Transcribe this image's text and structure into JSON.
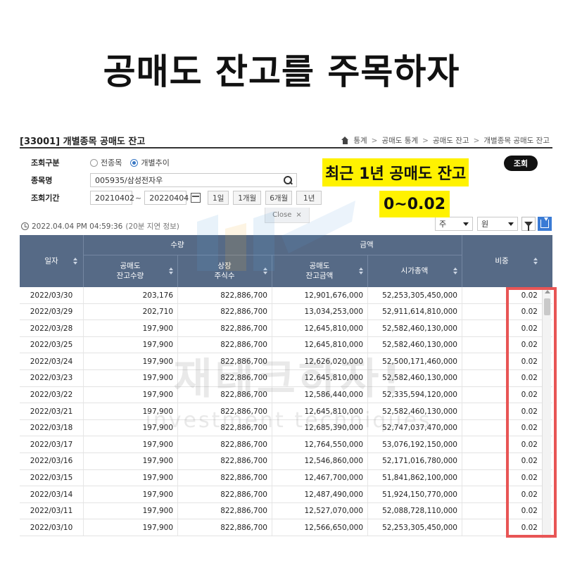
{
  "headline": "공매도 잔고를 주목하자",
  "screen": {
    "title": "[33001] 개별종목 공매도 잔고",
    "breadcrumb": [
      "통계",
      "공매도 통계",
      "공매도 잔고",
      "개별종목 공매도 잔고"
    ],
    "breadcrumb_sep": ">"
  },
  "form": {
    "lookup_type_label": "조회구분",
    "radio_all": "전종목",
    "radio_individual": "개별추이",
    "selected_radio": "개별추이",
    "stock_label": "종목명",
    "stock_value": "005935/삼성전자우",
    "period_label": "조회기간",
    "date_from": "20210402",
    "date_sep": "~",
    "date_to": "20220404",
    "period_buttons": [
      "1일",
      "1개월",
      "6개월",
      "1년"
    ],
    "query_button": "조회",
    "close_label": "Close",
    "close_x": "×"
  },
  "toolbar": {
    "timestamp": "2022.04.04 PM 04:59:36",
    "timestamp_note": "(20분 지연 정보)",
    "unit_select": "주",
    "currency_select": "원"
  },
  "table": {
    "group_headers": {
      "quantity": "수량",
      "amount": "금액"
    },
    "headers": {
      "date": "일자",
      "short_qty": [
        "공매도",
        "잔고수량"
      ],
      "listed_shares": [
        "상장",
        "주식수"
      ],
      "short_amount": [
        "공매도",
        "잔고금액"
      ],
      "market_cap": "시가총액",
      "ratio": "비중"
    },
    "rows": [
      [
        "2022/03/30",
        "203,176",
        "822,886,700",
        "12,901,676,000",
        "52,253,305,450,000",
        "0.02"
      ],
      [
        "2022/03/29",
        "202,710",
        "822,886,700",
        "13,034,253,000",
        "52,911,614,810,000",
        "0.02"
      ],
      [
        "2022/03/28",
        "197,900",
        "822,886,700",
        "12,645,810,000",
        "52,582,460,130,000",
        "0.02"
      ],
      [
        "2022/03/25",
        "197,900",
        "822,886,700",
        "12,645,810,000",
        "52,582,460,130,000",
        "0.02"
      ],
      [
        "2022/03/24",
        "197,900",
        "822,886,700",
        "12,626,020,000",
        "52,500,171,460,000",
        "0.02"
      ],
      [
        "2022/03/23",
        "197,900",
        "822,886,700",
        "12,645,810,000",
        "52,582,460,130,000",
        "0.02"
      ],
      [
        "2022/03/22",
        "197,900",
        "822,886,700",
        "12,586,440,000",
        "52,335,594,120,000",
        "0.02"
      ],
      [
        "2022/03/21",
        "197,900",
        "822,886,700",
        "12,645,810,000",
        "52,582,460,130,000",
        "0.02"
      ],
      [
        "2022/03/18",
        "197,900",
        "822,886,700",
        "12,685,390,000",
        "52,747,037,470,000",
        "0.02"
      ],
      [
        "2022/03/17",
        "197,900",
        "822,886,700",
        "12,764,550,000",
        "53,076,192,150,000",
        "0.02"
      ],
      [
        "2022/03/16",
        "197,900",
        "822,886,700",
        "12,546,860,000",
        "52,171,016,780,000",
        "0.02"
      ],
      [
        "2022/03/15",
        "197,900",
        "822,886,700",
        "12,467,700,000",
        "51,841,862,100,000",
        "0.02"
      ],
      [
        "2022/03/14",
        "197,900",
        "822,886,700",
        "12,487,490,000",
        "51,924,150,770,000",
        "0.02"
      ],
      [
        "2022/03/11",
        "197,900",
        "822,886,700",
        "12,527,070,000",
        "52,088,728,110,000",
        "0.02"
      ],
      [
        "2022/03/10",
        "197,900",
        "822,886,700",
        "12,566,650,000",
        "52,253,305,450,000",
        "0.02"
      ]
    ]
  },
  "annotation": {
    "line1": "최근 1년 공매도 잔고",
    "line2": "0~0.02"
  },
  "watermark": {
    "korean": "재테크하자!",
    "english": "investment techniques"
  },
  "colors": {
    "header_bg": "#566a86",
    "highlight_yellow": "#fff200",
    "highlight_border": "#e85555",
    "accent_blue": "#3a7bd5"
  }
}
